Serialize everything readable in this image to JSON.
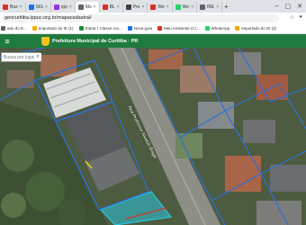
{
  "browser": {
    "tabs": [
      {
        "label": "Bus",
        "color": "#d93025"
      },
      {
        "label": "SIG",
        "color": "#1a73e8"
      },
      {
        "label": "ipp",
        "color": "#9334e6"
      },
      {
        "label": "Mo",
        "color": "#5f6368"
      },
      {
        "label": "BL",
        "color": "#d93025"
      },
      {
        "label": "Pre",
        "color": "#3c4043"
      },
      {
        "label": "We",
        "color": "#d93025"
      },
      {
        "label": "We",
        "color": "#25d366"
      },
      {
        "label": "IBE",
        "color": "#5f6368"
      }
    ],
    "active_tab_index": 3,
    "url": "geocuritiba.ippuc.org.br/mapacadastral/",
    "bookmarks": [
      {
        "label": "ado do E...",
        "color": "#5f6368"
      },
      {
        "label": "Importado do IE (1)",
        "color": "#f9ab00"
      },
      {
        "label": "Entrar | Classe roo...",
        "color": "#1e8e3e"
      },
      {
        "label": "Nova guia",
        "color": "#1a73e8"
      },
      {
        "label": "Meu Ambiente (Cl...",
        "color": "#d93025"
      },
      {
        "label": "WhatsApp",
        "color": "#25d366"
      },
      {
        "label": "Importado do IE (2)",
        "color": "#f9ab00"
      }
    ]
  },
  "app": {
    "title": "Prefeitura Municipal de Curitiba · PR",
    "header_color": "#1f7a3d",
    "search_placeholder": "Busca por lugar"
  },
  "map": {
    "street_label": "Rua Professor Nivaldo Braga",
    "lot_outline_color": "#2f6fd6",
    "highlight_fill": "#29c6d8"
  },
  "icons": {
    "menu": "menu-icon",
    "search": "search-icon",
    "close": "close-icon",
    "new_tab": "plus-icon"
  }
}
